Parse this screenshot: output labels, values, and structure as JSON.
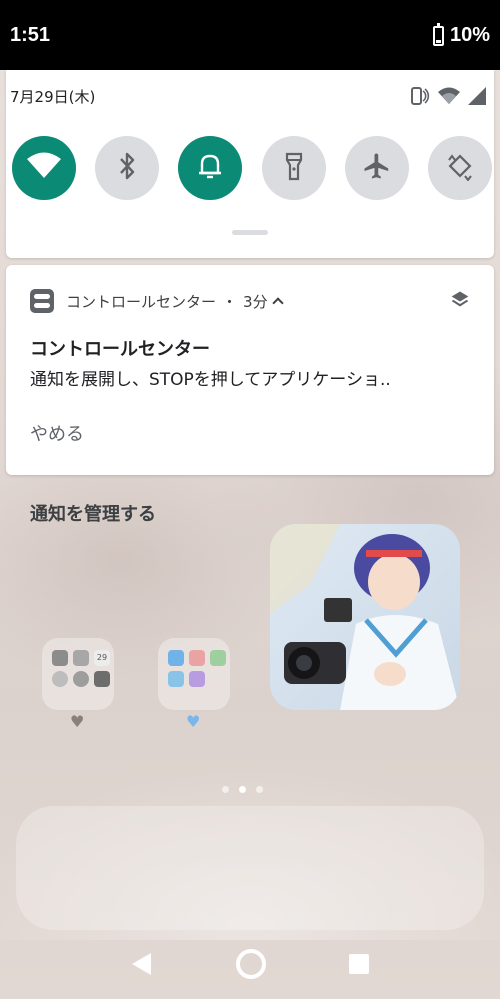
{
  "status_bar": {
    "time": "1:51",
    "battery": "10%"
  },
  "quick_settings": {
    "date": "7月29日(木)",
    "tiles": [
      {
        "name": "wifi",
        "active": true
      },
      {
        "name": "bluetooth",
        "active": false
      },
      {
        "name": "notification-sound",
        "active": true
      },
      {
        "name": "flashlight",
        "active": false
      },
      {
        "name": "airplane-mode",
        "active": false
      },
      {
        "name": "auto-rotate",
        "active": false
      }
    ],
    "accent_color": "#0b8a76"
  },
  "notification": {
    "app_name": "コントロールセンター",
    "separator": "・",
    "time": "3分",
    "title": "コントロールセンター",
    "body": "通知を展開し、STOPを押してアプリケーショ..",
    "action": "やめる"
  },
  "manage_notifications": "通知を管理する",
  "home": {
    "folder1_icon": "folder-icon",
    "folder2_icon": "folder-icon",
    "mini_label": "29"
  }
}
